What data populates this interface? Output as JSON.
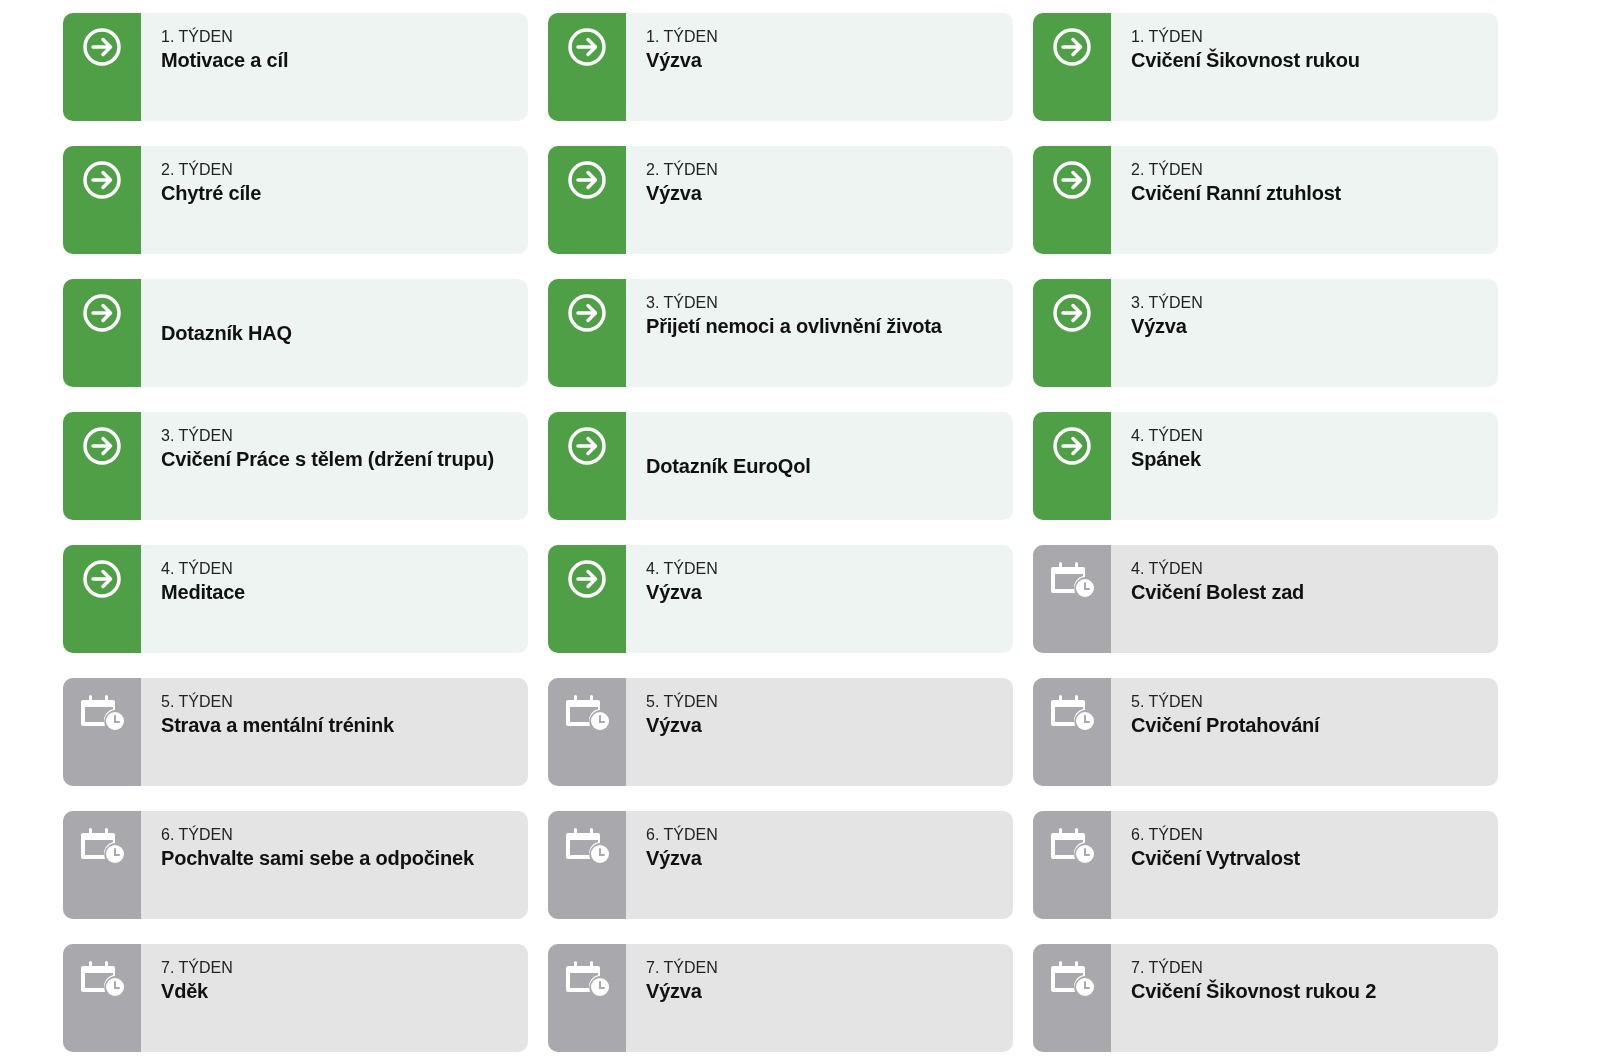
{
  "rows": [
    {
      "cards": [
        {
          "kind": "open",
          "week": "1. TÝDEN",
          "title": "Motivace a cíl"
        },
        {
          "kind": "open",
          "week": "1. TÝDEN",
          "title": "Výzva"
        },
        {
          "kind": "open",
          "week": "1. TÝDEN",
          "title": "Cvičení Šikovnost rukou"
        }
      ]
    },
    {
      "cards": [
        {
          "kind": "open",
          "week": "2. TÝDEN",
          "title": "Chytré cíle"
        },
        {
          "kind": "open",
          "week": "2. TÝDEN",
          "title": "Výzva"
        },
        {
          "kind": "open",
          "week": "2. TÝDEN",
          "title": "Cvičení Ranní ztuhlost"
        }
      ]
    },
    {
      "cards": [
        {
          "kind": "open",
          "title": "Dotazník HAQ"
        },
        {
          "kind": "open",
          "week": "3. TÝDEN",
          "title": "Přijetí nemoci a ovlivnění života"
        },
        {
          "kind": "open",
          "week": "3. TÝDEN",
          "title": "Výzva"
        }
      ]
    },
    {
      "cards": [
        {
          "kind": "open",
          "week": "3. TÝDEN",
          "title": "Cvičení Práce s tělem (držení trupu)"
        },
        {
          "kind": "open",
          "title": "Dotazník EuroQol"
        },
        {
          "kind": "open",
          "week": "4. TÝDEN",
          "title": "Spánek"
        }
      ]
    },
    {
      "cards": [
        {
          "kind": "open",
          "week": "4. TÝDEN",
          "title": "Meditace"
        },
        {
          "kind": "open",
          "week": "4. TÝDEN",
          "title": "Výzva"
        },
        {
          "kind": "scheduled",
          "week": "4. TÝDEN",
          "title": "Cvičení Bolest zad"
        }
      ]
    },
    {
      "cards": [
        {
          "kind": "scheduled",
          "week": "5. TÝDEN",
          "title": "Strava a mentální trénink"
        },
        {
          "kind": "scheduled",
          "week": "5. TÝDEN",
          "title": "Výzva"
        },
        {
          "kind": "scheduled",
          "week": "5. TÝDEN",
          "title": "Cvičení Protahování"
        }
      ]
    },
    {
      "cards": [
        {
          "kind": "scheduled",
          "week": "6. TÝDEN",
          "title": "Pochvalte sami sebe a odpočinek"
        },
        {
          "kind": "scheduled",
          "week": "6. TÝDEN",
          "title": "Výzva"
        },
        {
          "kind": "scheduled",
          "week": "6. TÝDEN",
          "title": "Cvičení Vytrvalost"
        }
      ]
    },
    {
      "cards": [
        {
          "kind": "scheduled",
          "week": "7. TÝDEN",
          "title": "Vděk"
        },
        {
          "kind": "scheduled",
          "week": "7. TÝDEN",
          "title": "Výzva"
        },
        {
          "kind": "scheduled",
          "week": "7. TÝDEN",
          "title": "Cvičení Šikovnost rukou 2"
        }
      ]
    }
  ]
}
